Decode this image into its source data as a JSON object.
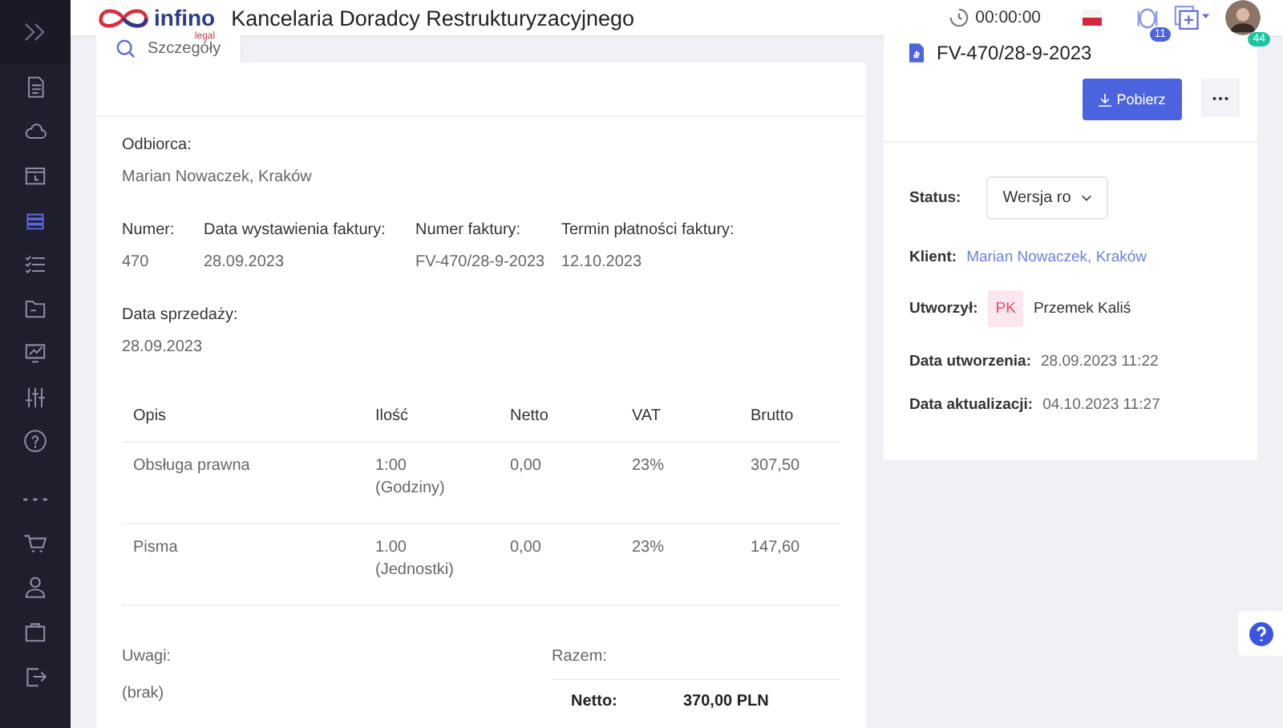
{
  "sidebar": {
    "items": [
      {
        "kind": "doc",
        "selected": false
      },
      {
        "kind": "cloud",
        "selected": false
      },
      {
        "kind": "calendar",
        "selected": false
      },
      {
        "kind": "stack",
        "selected": true
      },
      {
        "kind": "checklist",
        "selected": false
      },
      {
        "kind": "folder",
        "selected": false
      },
      {
        "kind": "monitor",
        "selected": false
      },
      {
        "kind": "sliders",
        "selected": false
      },
      {
        "kind": "help",
        "selected": false
      },
      {
        "kind": "more",
        "selected": false
      },
      {
        "kind": "cart",
        "selected": false
      },
      {
        "kind": "user",
        "selected": false
      },
      {
        "kind": "briefcase",
        "selected": false
      },
      {
        "kind": "logout",
        "selected": false
      }
    ]
  },
  "header": {
    "logo": {
      "name": "infino",
      "sub": "legal"
    },
    "title": "Kancelaria Doradcy Restrukturyzacyjnego",
    "timer": "00:00:00",
    "coins_badge": "11",
    "avatar_badge": "44"
  },
  "tabs": [
    {
      "label": "Szczegóły",
      "selected": true
    }
  ],
  "invoice": {
    "recipient": {
      "label": "Odbiorca:",
      "value": "Marian Nowaczek, Kraków"
    },
    "fields": [
      {
        "label": "Numer:",
        "value": "470"
      },
      {
        "label": "Data wystawienia faktury:",
        "value": "28.09.2023"
      },
      {
        "label": "Numer faktury:",
        "value": "FV-470/28-9-2023"
      },
      {
        "label": "Termin płatności faktury:",
        "value": "12.10.2023"
      }
    ],
    "sale_date": {
      "label": "Data sprzedaży:",
      "value": "28.09.2023"
    },
    "table": {
      "columns": [
        "Opis",
        "Ilość",
        "Netto",
        "VAT",
        "Brutto"
      ],
      "rows": [
        {
          "cells": [
            "Obsługa prawna",
            "1:00",
            "0,00",
            "23%",
            "307,50"
          ],
          "unit": "(Godziny)"
        },
        {
          "cells": [
            "Pisma",
            "1.00",
            "0,00",
            "23%",
            "147,60"
          ],
          "unit": "(Jednostki)"
        }
      ]
    },
    "notes": {
      "label": "Uwagi:",
      "value": "(brak)"
    },
    "totals": {
      "label": "Razem:",
      "rows": [
        {
          "label": "Netto:",
          "value": "370,00 PLN"
        }
      ]
    }
  },
  "details": {
    "title": "FV-470/28-9-2023",
    "download": "Pobierz",
    "status": {
      "label": "Status:",
      "value": "Wersja ro"
    },
    "client": {
      "label": "Klient:",
      "value": "Marian Nowaczek, Kraków"
    },
    "creator": {
      "label": "Utworzył:",
      "initials": "PK",
      "name": "Przemek Kaliś"
    },
    "dates": [
      {
        "label": "Data utworzenia:",
        "value": "28.09.2023 11:22"
      },
      {
        "label": "Data aktualizacji:",
        "value": "04.10.2023 11:27"
      }
    ]
  }
}
